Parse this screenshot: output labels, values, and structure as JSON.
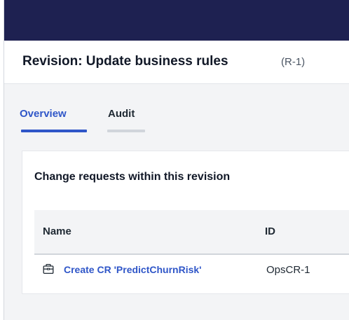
{
  "page": {
    "title": "Revision: Update business rules",
    "id": "(R-1)"
  },
  "tabs": [
    {
      "label": "Overview",
      "active": true
    },
    {
      "label": "Audit",
      "active": false
    }
  ],
  "card": {
    "title": "Change requests within this revision",
    "table": {
      "columns": [
        "Name",
        "ID"
      ],
      "rows": [
        {
          "icon": "briefcase-icon",
          "name": "Create CR 'PredictChurnRisk'",
          "id": "OpsCR-1"
        }
      ]
    }
  },
  "colors": {
    "topbar": "#1e2151",
    "accent": "#2f56c8",
    "content_background": "#f3f4f6"
  }
}
